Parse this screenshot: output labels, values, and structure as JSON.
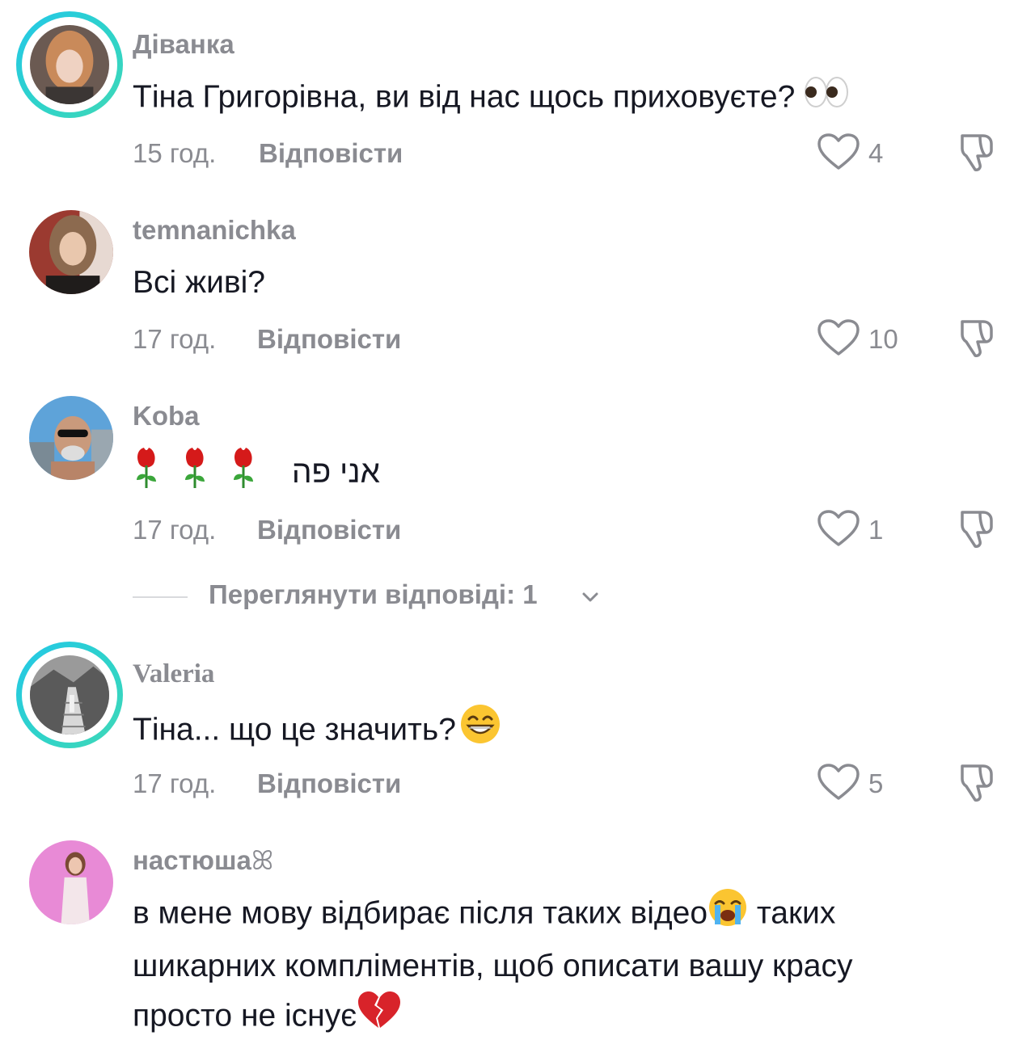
{
  "comments": [
    {
      "username": "Діванка",
      "text": "Тіна Григорівна, ви від нас щось приховуєте? ",
      "emoji": "eyes",
      "time": "15 год.",
      "reply_label": "Відповісти",
      "likes": "4",
      "has_story_ring": true
    },
    {
      "username": "temnanichka",
      "text": "Всі живі?",
      "time": "17 год.",
      "reply_label": "Відповісти",
      "likes": "10",
      "has_story_ring": false
    },
    {
      "username": "Koba",
      "text": "אני פה",
      "emoji": "rose x3",
      "time": "17 год.",
      "reply_label": "Відповісти",
      "likes": "1",
      "has_story_ring": false
    },
    {
      "username": "Valeria",
      "text": "Тіна... що це значить?",
      "emoji": "grinning face with smiling eyes",
      "time": "17 год.",
      "reply_label": "Відповісти",
      "likes": "5",
      "has_story_ring": true
    },
    {
      "username": "настюша",
      "username_suffix": "ꕤ",
      "text_line1": "в мене мову відбирає після таких відео",
      "text_line1_after": " таких",
      "text_line2": "шикарних компліментів, щоб описати вашу красу",
      "text_line3": "просто не існує",
      "emoji": "loudly crying face, broken heart",
      "has_story_ring": false
    }
  ],
  "view_replies": {
    "label": "Переглянути відповіді: 1"
  },
  "colors": {
    "text": "#161823",
    "secondary": "#8a8b91",
    "story_ring": "#23c7e8"
  },
  "icons": [
    "heart-outline-icon",
    "thumbs-down-icon",
    "chevron-down-icon"
  ]
}
